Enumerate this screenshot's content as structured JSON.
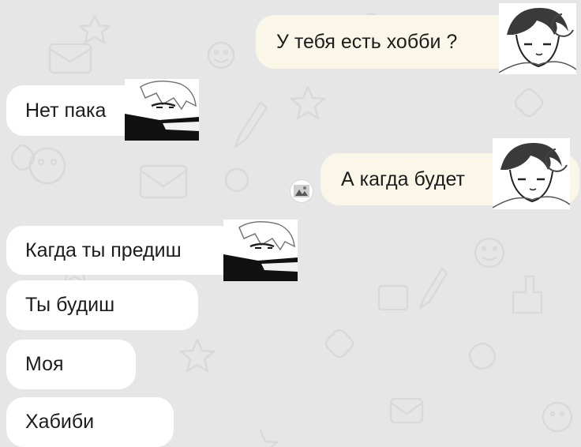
{
  "chat": {
    "messages": [
      {
        "direction": "outgoing",
        "text": "У тебя есть хобби ?"
      },
      {
        "direction": "incoming",
        "text": "Нет пака"
      },
      {
        "direction": "outgoing",
        "text": "А кагда будет"
      },
      {
        "direction": "incoming",
        "text": "Кагда ты предиш"
      },
      {
        "direction": "incoming",
        "text": "Ты будиш"
      },
      {
        "direction": "incoming",
        "text": "Моя"
      },
      {
        "direction": "incoming",
        "text": "Хабиби"
      }
    ]
  },
  "colors": {
    "wallpaper": "#e6e6e6",
    "incoming_bubble": "#ffffff",
    "outgoing_bubble": "#fbf7e8",
    "text": "#1c1c1c"
  },
  "icons": {
    "sticker_outgoing": "anime-boy-sticker",
    "sticker_incoming": "white-haired-masked-anime-sticker",
    "reaction": "small-image-reaction"
  }
}
